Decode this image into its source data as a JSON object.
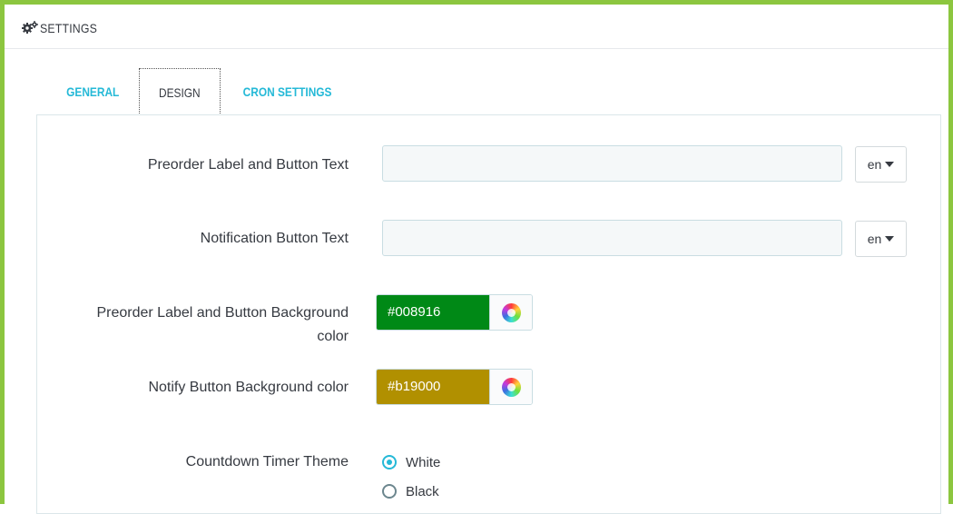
{
  "header": {
    "title": "SETTINGS",
    "icon": "gears-icon"
  },
  "tabs": [
    {
      "label": "GENERAL",
      "active": false
    },
    {
      "label": "DESIGN",
      "active": true
    },
    {
      "label": "CRON SETTINGS",
      "active": false
    }
  ],
  "fields": {
    "preorder_text": {
      "label": "Preorder Label and Button Text",
      "value": "",
      "lang": "en"
    },
    "notification_text": {
      "label": "Notification Button Text",
      "value": "",
      "lang": "en"
    },
    "preorder_bg": {
      "label_line1": "Preorder Label and Button Background",
      "label_line2": "color",
      "value": "#008916"
    },
    "notify_bg": {
      "label": "Notify Button Background color",
      "value": "#b19000"
    },
    "timer_theme": {
      "label": "Countdown Timer Theme",
      "options": [
        {
          "label": "White",
          "checked": true
        },
        {
          "label": "Black",
          "checked": false
        }
      ]
    }
  },
  "colors": {
    "accent": "#25b9d7",
    "frame": "#8cc63f"
  }
}
